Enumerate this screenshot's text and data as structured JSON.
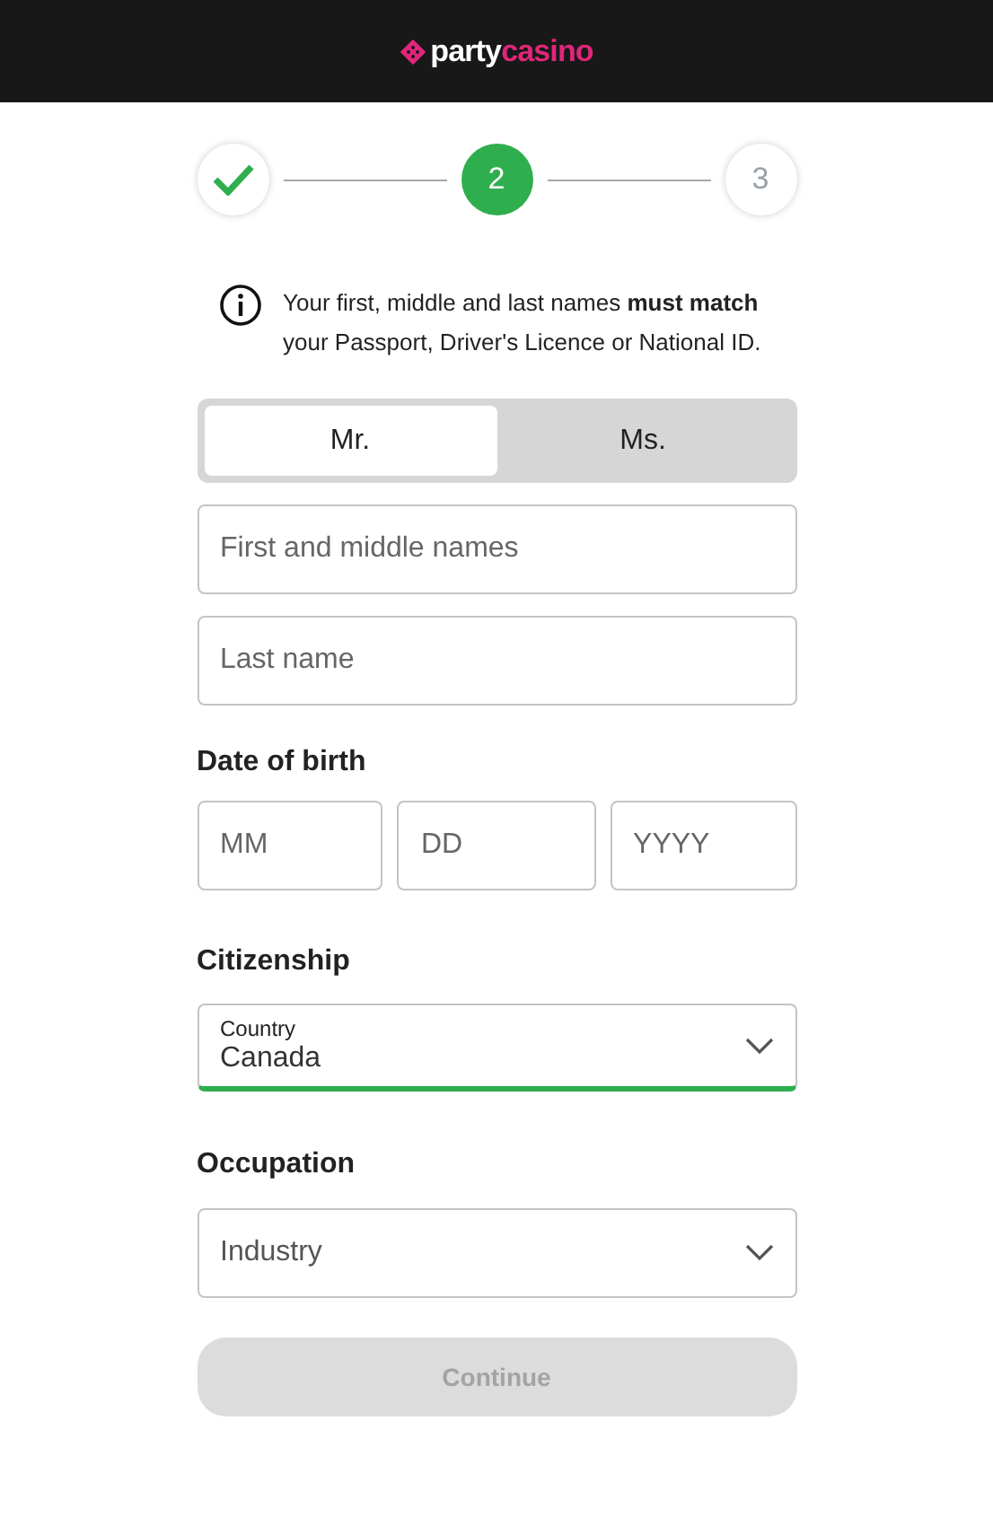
{
  "header": {
    "logo": [
      "party",
      "casino"
    ]
  },
  "steps": [
    {
      "kind": "done"
    },
    {
      "kind": "current",
      "label": "2"
    },
    {
      "kind": "upcoming",
      "label": "3"
    }
  ],
  "notice": "Your first, middle and last names **must match** your Passport, Driver's Licence or National ID.",
  "title_toggle": [
    {
      "label": "Mr.",
      "selected": true
    },
    {
      "label": "Ms.",
      "selected": false
    }
  ],
  "name_fields": [
    {
      "placeholder": "First and middle names"
    },
    {
      "placeholder": "Last name"
    }
  ],
  "dob": {
    "label": "Date of birth",
    "fields": [
      {
        "placeholder": "MM"
      },
      {
        "placeholder": "DD"
      },
      {
        "placeholder": "YYYY"
      }
    ]
  },
  "citizenship": {
    "label": "Citizenship",
    "select": {
      "floating_label": "Country",
      "value": "Canada",
      "valid": true
    }
  },
  "occupation": {
    "label": "Occupation",
    "select": {
      "placeholder": "Industry",
      "valid": false
    }
  },
  "continue_button": {
    "label": "Continue",
    "disabled": true
  }
}
